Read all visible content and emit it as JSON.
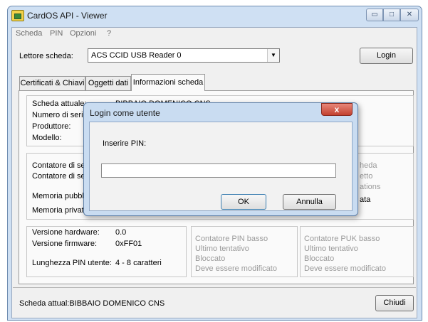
{
  "window": {
    "title": "CardOS API - Viewer",
    "min_glyph": "▭",
    "max_glyph": "□",
    "close_glyph": "✕"
  },
  "menu": [
    "Scheda",
    "PIN",
    "Opzioni",
    "?"
  ],
  "reader": {
    "label": "Lettore scheda:",
    "value": "ACS CCID USB Reader 0",
    "login_label": "Login"
  },
  "tabs": [
    {
      "label": "Certificati & Chiavi"
    },
    {
      "label": "Oggetti dati"
    },
    {
      "label": "Informazioni scheda",
      "active": true
    }
  ],
  "card_info": {
    "labels": [
      "Scheda attuale:",
      "Numero di serie:",
      "Produttore:",
      "Modello:"
    ],
    "scheda_attuale_value": "BIBBAIO DOMENICO CNS"
  },
  "memory": {
    "labels": [
      "Contatore di ses",
      "Contatore di ses",
      "Memoria pubblic",
      "Memoria privata"
    ],
    "right_states": [
      "heda",
      "etto",
      "ations",
      "ata"
    ]
  },
  "versions": {
    "hw_label": "Versione hardware:",
    "hw_value": "0.0",
    "fw_label": "Versione firmware:",
    "fw_value": "0xFF01",
    "pin_len_label": "Lunghezza PIN utente:",
    "pin_len_value": "4 - 8 caratteri"
  },
  "pin_status": {
    "items": [
      "Contatore PIN basso",
      "Ultimo tentativo",
      "Bloccato",
      "Deve essere modificato"
    ]
  },
  "puk_status": {
    "items": [
      "Contatore PUK basso",
      "Ultimo tentativo",
      "Bloccato",
      "Deve essere modificato"
    ]
  },
  "statusbar": {
    "text": "Scheda attual:BIBBAIO DOMENICO CNS",
    "close_label": "Chiudi"
  },
  "dialog": {
    "title": "Login come utente",
    "prompt": "Inserire PIN:",
    "pin_value": "",
    "ok_label": "OK",
    "cancel_label": "Annulla",
    "close_glyph": "x"
  },
  "colors": {
    "titlebar": "#cfe0f3",
    "dialog_close": "#c2412f",
    "disabled_text": "#9a9a9a"
  }
}
